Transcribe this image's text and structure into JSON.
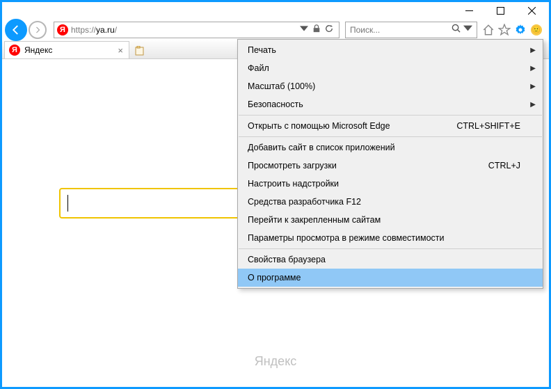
{
  "address": {
    "prefix": "https://",
    "host": "ya.ru",
    "path": "/"
  },
  "search": {
    "placeholder": "Поиск..."
  },
  "tab": {
    "title": "Яндекс"
  },
  "page": {
    "footer": "Яндекс"
  },
  "menu": {
    "print": "Печать",
    "file": "Файл",
    "zoom": "Масштаб (100%)",
    "safety": "Безопасность",
    "edge": "Открыть с помощью Microsoft Edge",
    "edge_sc": "CTRL+SHIFT+E",
    "addApp": "Добавить сайт в список приложений",
    "downloads": "Просмотреть загрузки",
    "downloads_sc": "CTRL+J",
    "addons": "Настроить надстройки",
    "f12": "Средства разработчика F12",
    "pinned": "Перейти к закрепленным сайтам",
    "compat": "Параметры просмотра в режиме совместимости",
    "props": "Свойства браузера",
    "about": "О программе"
  }
}
